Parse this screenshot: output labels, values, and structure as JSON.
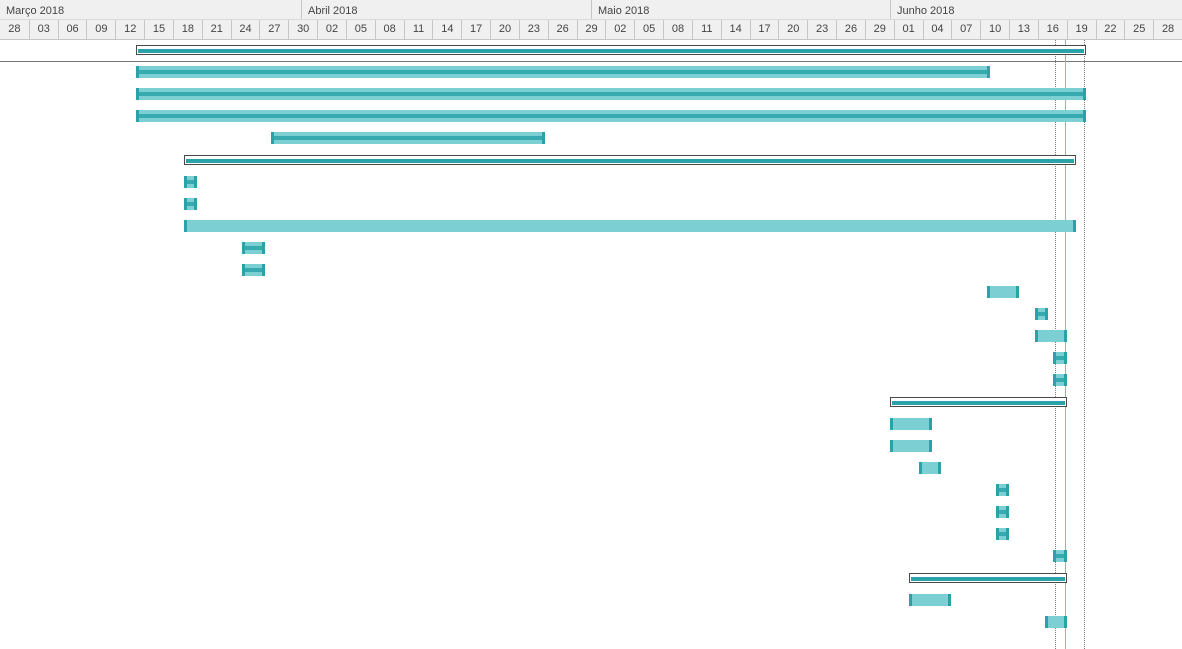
{
  "timescale": {
    "months": [
      "Março 2018",
      "Abril 2018",
      "Maio 2018",
      "Junho 2018"
    ],
    "days": [
      "28",
      "03",
      "06",
      "09",
      "12",
      "15",
      "18",
      "21",
      "24",
      "27",
      "30",
      "02",
      "05",
      "08",
      "11",
      "14",
      "17",
      "20",
      "23",
      "26",
      "29",
      "02",
      "05",
      "08",
      "11",
      "14",
      "17",
      "20",
      "23",
      "26",
      "29",
      "01",
      "04",
      "07",
      "10",
      "13",
      "16",
      "19",
      "22",
      "25",
      "28"
    ]
  },
  "colors": {
    "bar_fill": "#7ccfd2",
    "bar_accent": "#2aa3a8",
    "summary_border": "#4a4a4a",
    "status_line": "#8fbf8f"
  }
}
